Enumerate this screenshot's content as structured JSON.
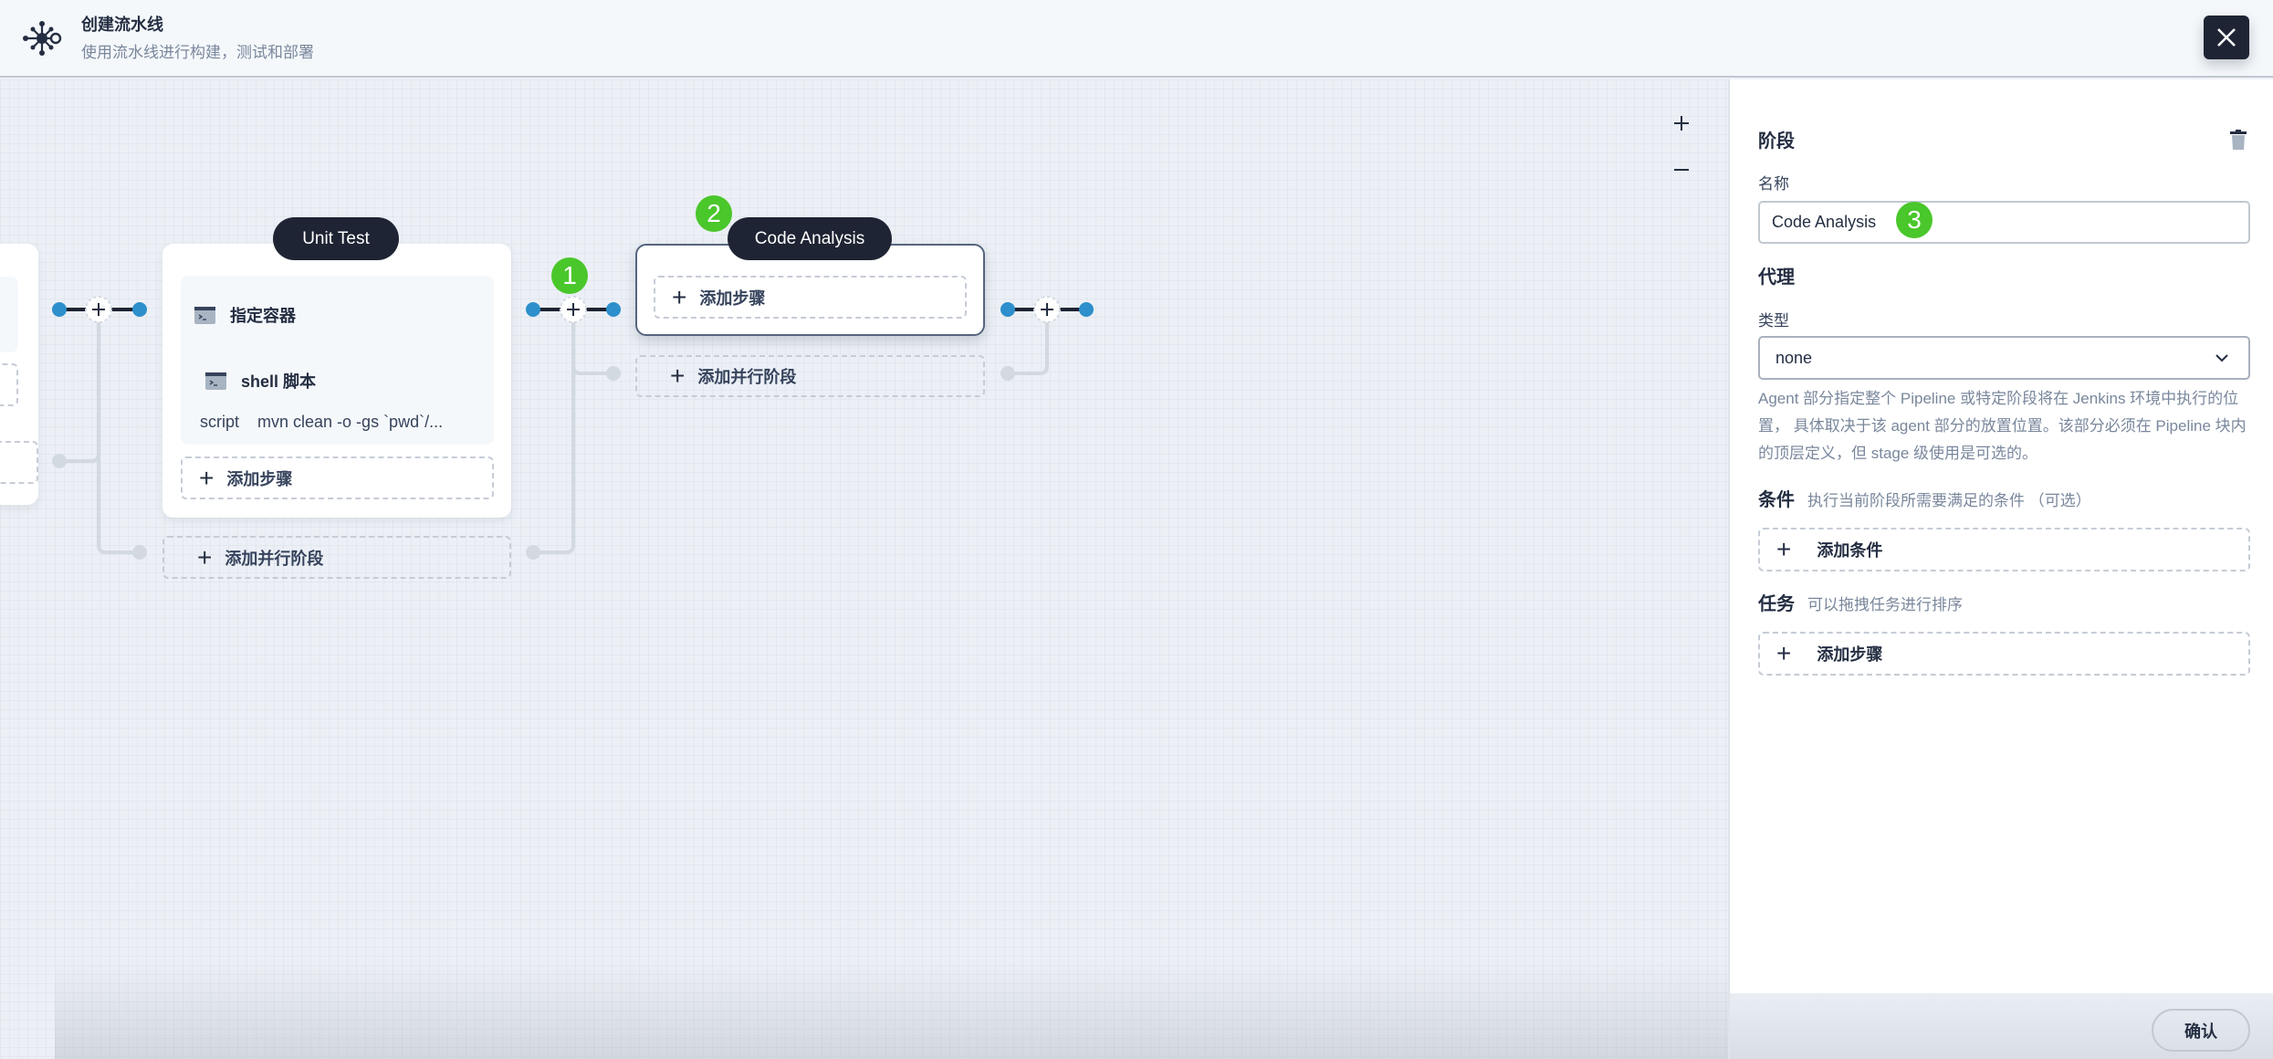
{
  "header": {
    "title": "创建流水线",
    "subtitle": "使用流水线进行构建，测试和部署",
    "close_icon": "close-icon",
    "logo_icon": "pipeline-network-icon"
  },
  "canvas": {
    "zoom_in_icon": "plus-icon",
    "zoom_out_icon": "minus-icon",
    "stages": [
      {
        "name": "Unit Test",
        "steps": [
          {
            "icon": "terminal-icon",
            "label": "指定容器"
          },
          {
            "icon": "terminal-icon",
            "label": "shell 脚本",
            "param_key": "script",
            "param_value": "mvn clean -o -gs `pwd`/..."
          }
        ],
        "add_step_label": "添加步骤",
        "add_parallel_label": "添加并行阶段"
      },
      {
        "name": "Code Analysis",
        "selected": true,
        "steps": [],
        "add_step_label": "添加步骤",
        "add_parallel_label": "添加并行阶段"
      }
    ],
    "annotations": [
      "1",
      "2",
      "3"
    ]
  },
  "panel": {
    "stage_title": "阶段",
    "name_label": "名称",
    "name_value": "Code Analysis",
    "agent_title": "代理",
    "type_label": "类型",
    "type_value": "none",
    "agent_description": "Agent 部分指定整个 Pipeline 或特定阶段将在 Jenkins 环境中执行的位置， 具体取决于该 agent 部分的放置位置。该部分必须在 Pipeline 块内的顶层定义，但 stage 级使用是可选的。",
    "conditions_title": "条件",
    "conditions_hint": "执行当前阶段所需要满足的条件 （可选）",
    "add_condition_label": "添加条件",
    "tasks_title": "任务",
    "tasks_hint": "可以拖拽任务进行排序",
    "add_step_label": "添加步骤",
    "confirm_label": "确认"
  },
  "colors": {
    "accent_dark": "#1e2433",
    "node_blue": "#2d8fcb",
    "annotation_green": "#4ac72b"
  }
}
